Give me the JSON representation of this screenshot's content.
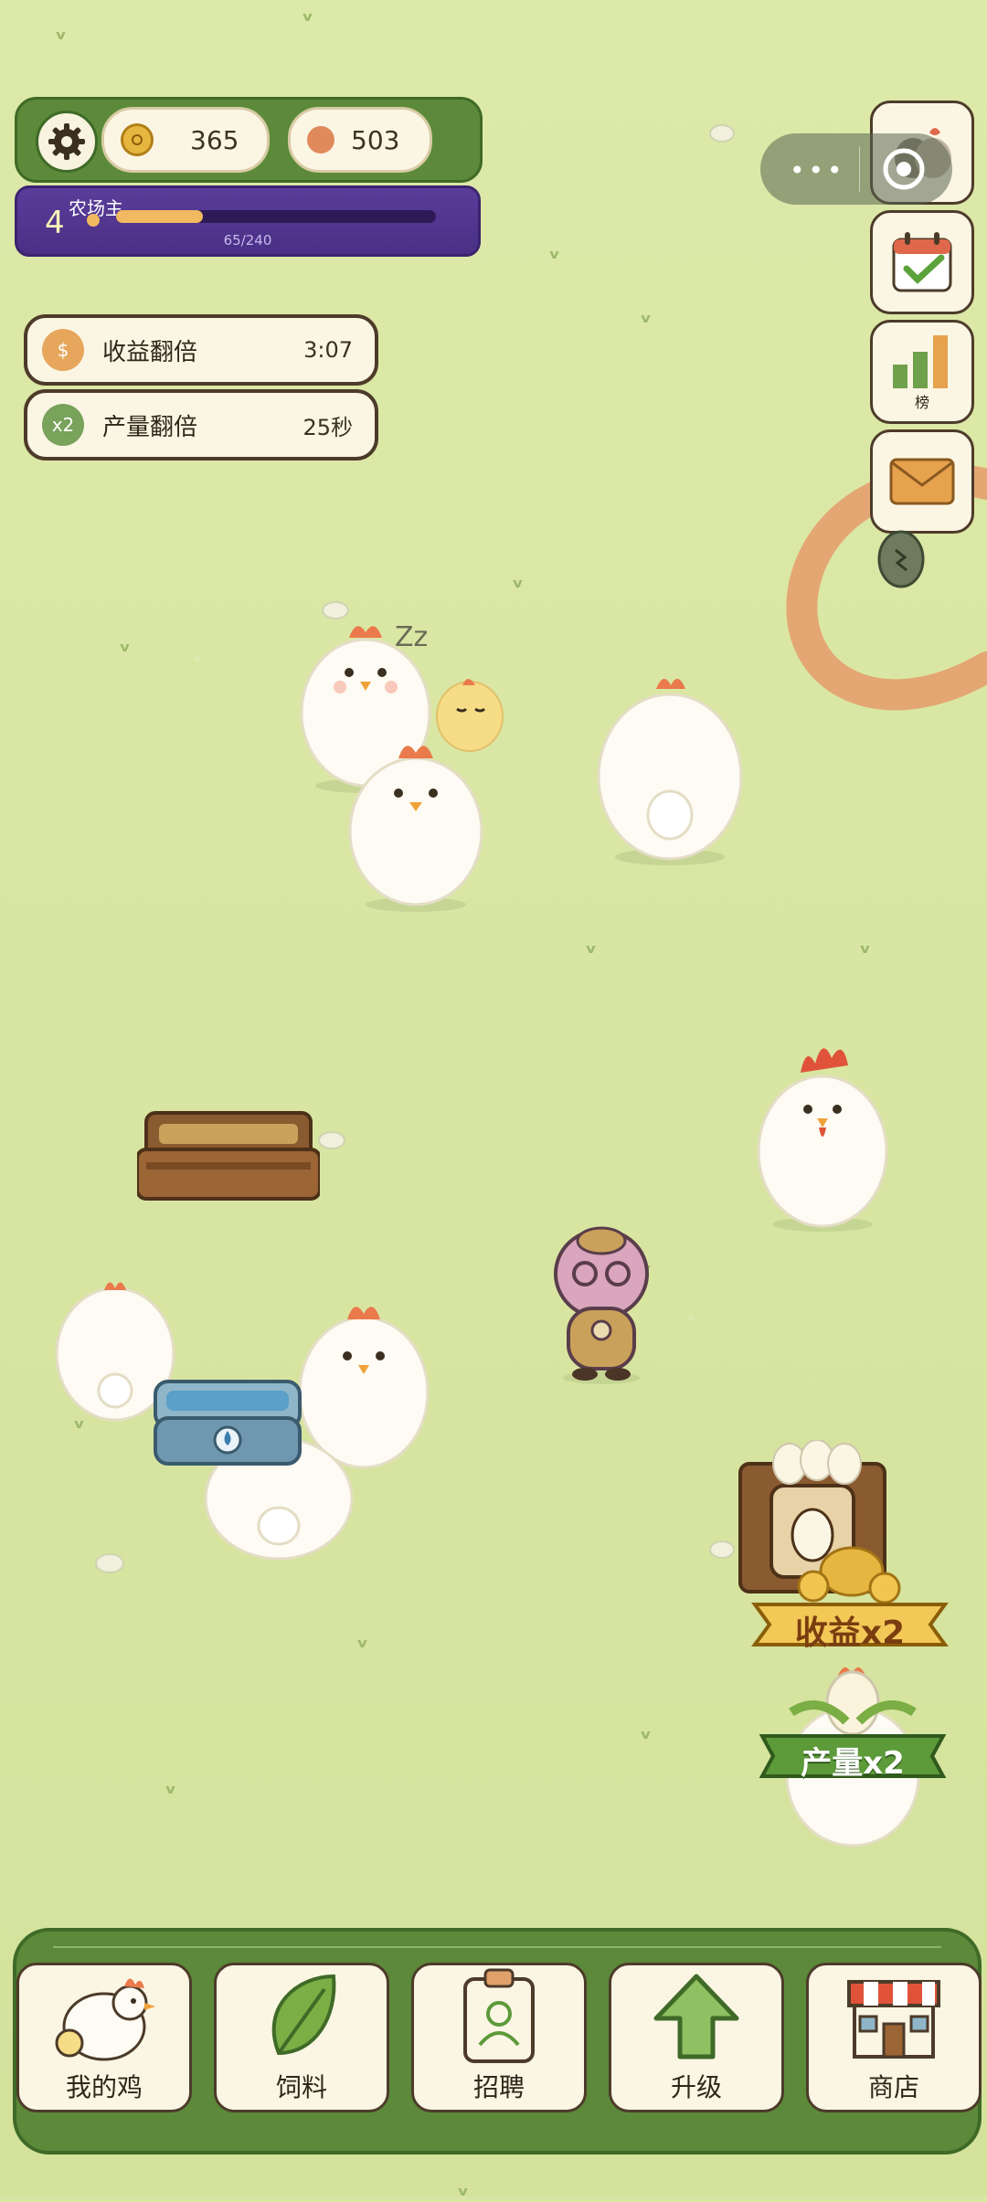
{
  "currency": {
    "coins": "365",
    "gems": "503"
  },
  "level": {
    "number": "4",
    "title": "农场主",
    "xp_text": "65/240",
    "progress": 0.27
  },
  "buffs": [
    {
      "icon": "$",
      "name": "收益翻倍",
      "time": "3:07",
      "color": "#e6a65c"
    },
    {
      "icon": "x2",
      "name": "产量翻倍",
      "time": "25秒",
      "color": "#79a25b"
    }
  ],
  "side_menu": {
    "leaderboard_label": "榜"
  },
  "boosts": {
    "income_label": "收益x2",
    "production_label": "产量x2"
  },
  "nav": [
    {
      "label": "我的鸡",
      "icon": "chicken-icon"
    },
    {
      "label": "饲料",
      "icon": "leaf-icon"
    },
    {
      "label": "招聘",
      "icon": "id-badge-icon"
    },
    {
      "label": "升级",
      "icon": "up-arrow-icon"
    },
    {
      "label": "商店",
      "icon": "shop-icon"
    }
  ],
  "colors": {
    "grass": "#d9e6a3",
    "nav_green": "#5c8a3a",
    "level_purple": "#5a3d9a",
    "cream": "#fbf6e4"
  }
}
